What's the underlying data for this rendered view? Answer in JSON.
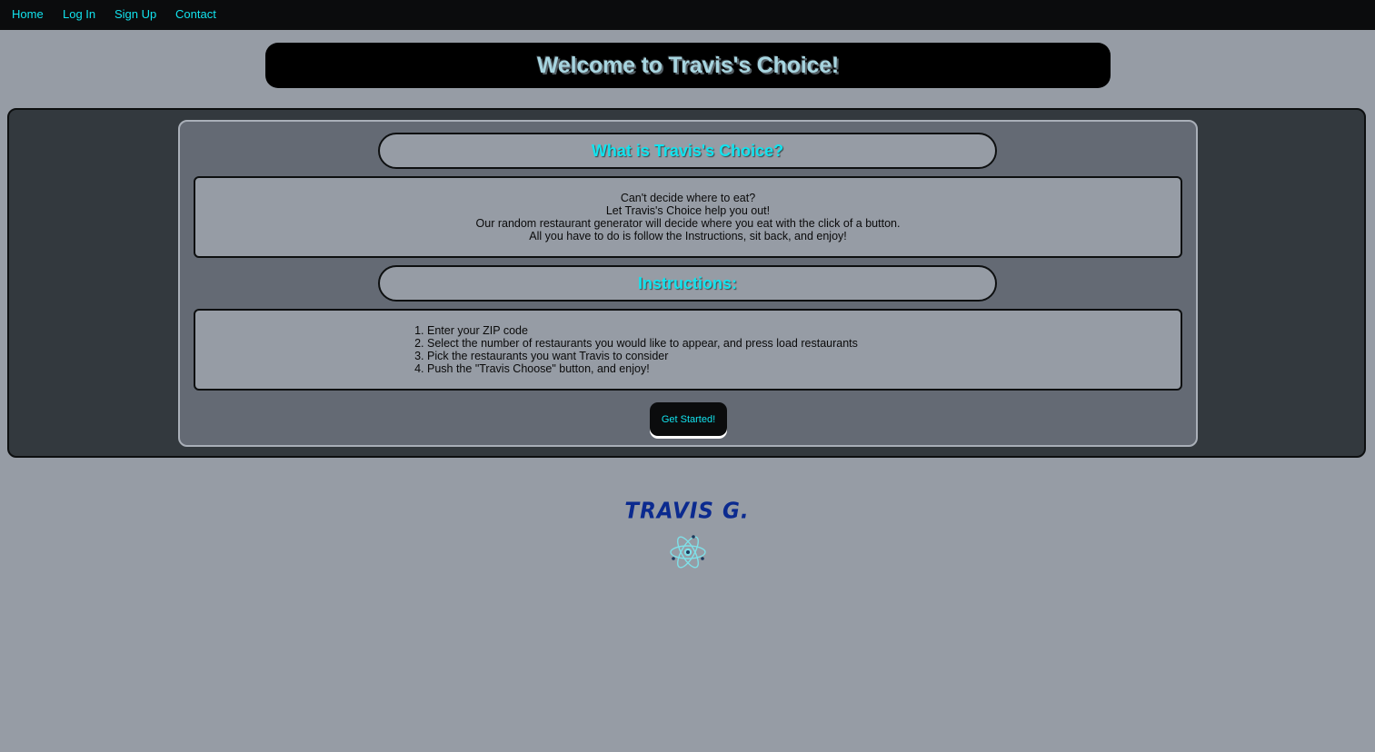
{
  "nav": {
    "items": [
      "Home",
      "Log In",
      "Sign Up",
      "Contact"
    ]
  },
  "hero": {
    "title": "Welcome to Travis's Choice!"
  },
  "about": {
    "heading": "What is Travis's Choice?",
    "lines": [
      "Can't decide where to eat?",
      "Let Travis's Choice help you out!",
      "Our random restaurant generator will decide where you eat with the click of a button.",
      "All you have to do is follow the Instructions, sit back, and enjoy!"
    ]
  },
  "instructions": {
    "heading": "Instructions:",
    "steps": [
      "Enter your ZIP code",
      "Select the number of restaurants you would like to appear, and press load restaurants",
      "Pick the restaurants you want Travis to consider",
      "Push the \"Travis Choose\" button, and enjoy!"
    ]
  },
  "cta": {
    "label": "Get Started!"
  },
  "footer": {
    "signature": "TRAVIS G.",
    "logo_icon": "atom-icon"
  },
  "colors": {
    "accent": "#12e3ee",
    "page_bg": "#969ca5",
    "panel_dark": "#33393e",
    "panel_mid": "#646a74",
    "nav_bg": "#0b0c0d",
    "signature": "#0b2a8f"
  }
}
